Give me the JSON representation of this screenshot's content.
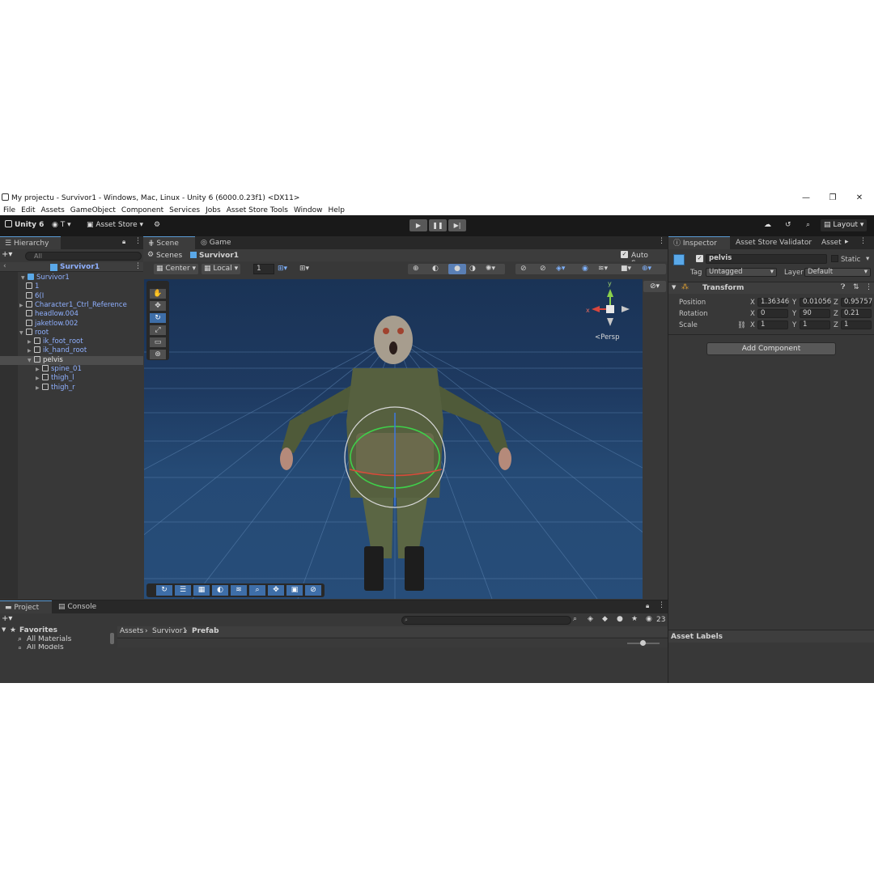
{
  "window": {
    "title": "My projectu - Survivor1 - Windows, Mac, Linux - Unity 6 (6000.0.23f1) <DX11>",
    "minimize": "—",
    "restore": "❐",
    "close": "✕"
  },
  "menu": [
    "File",
    "Edit",
    "Assets",
    "GameObject",
    "Component",
    "Services",
    "Jobs",
    "Asset Store Tools",
    "Window",
    "Help"
  ],
  "toolbar": {
    "unity_label": "Unity 6",
    "account_label": "T",
    "asset_store_label": "Asset Store",
    "layout_label": "Layout"
  },
  "hierarchy": {
    "tab": "Hierarchy",
    "search_placeholder": "All",
    "root_label": "Survivor1",
    "items": [
      {
        "label": "Survivor1",
        "indent": 1,
        "arrow": "▼",
        "selected": false
      },
      {
        "label": "1",
        "indent": 2,
        "arrow": "",
        "selected": false
      },
      {
        "label": "6(I",
        "indent": 2,
        "arrow": "",
        "selected": false
      },
      {
        "label": "Character1_Ctrl_Reference",
        "indent": 2,
        "arrow": "▶",
        "selected": false
      },
      {
        "label": "headlow.004",
        "indent": 2,
        "arrow": "",
        "selected": false
      },
      {
        "label": "jaketlow.002",
        "indent": 2,
        "arrow": "",
        "selected": false
      },
      {
        "label": "root",
        "indent": 2,
        "arrow": "▼",
        "selected": false
      },
      {
        "label": "ik_foot_root",
        "indent": 3,
        "arrow": "▶",
        "selected": false
      },
      {
        "label": "ik_hand_root",
        "indent": 3,
        "arrow": "▶",
        "selected": false
      },
      {
        "label": "pelvis",
        "indent": 3,
        "arrow": "▼",
        "selected": true
      },
      {
        "label": "spine_01",
        "indent": 4,
        "arrow": "▶",
        "selected": false
      },
      {
        "label": "thigh_l",
        "indent": 4,
        "arrow": "▶",
        "selected": false
      },
      {
        "label": "thigh_r",
        "indent": 4,
        "arrow": "▶",
        "selected": false
      }
    ]
  },
  "scene": {
    "tab_scene": "Scene",
    "tab_game": "Game",
    "breadcrumb_scenes": "Scenes",
    "breadcrumb_current": "Survivor1",
    "auto_save": "Auto Save",
    "pivot_center": "Center",
    "pivot_local": "Local",
    "grid_value": "1",
    "persp_label": "<Persp",
    "gizmo_y": "y",
    "gizmo_x": "x"
  },
  "inspector": {
    "tab_inspector": "Inspector",
    "tab_validator": "Asset Store Validator",
    "tab_asset": "Asset S",
    "object_name": "pelvis",
    "static_label": "Static",
    "tag_label": "Tag",
    "tag_value": "Untagged",
    "layer_label": "Layer",
    "layer_value": "Default",
    "transform_label": "Transform",
    "position_label": "Position",
    "rotation_label": "Rotation",
    "scale_label": "Scale",
    "position": {
      "x": "1.36346",
      "y": "0.01056",
      "z": "0.95757"
    },
    "rotation": {
      "x": "0",
      "y": "90",
      "z": "0.21"
    },
    "scale": {
      "x": "1",
      "y": "1",
      "z": "1"
    },
    "axis_x": "X",
    "axis_y": "Y",
    "axis_z": "Z",
    "add_component": "Add Component",
    "asset_labels": "Asset Labels"
  },
  "project": {
    "tab_project": "Project",
    "tab_console": "Console",
    "favorites": "Favorites",
    "all_materials": "All Materials",
    "all_models": "All Models",
    "path": [
      "Assets",
      "Survivor1",
      "Prefab"
    ],
    "hidden_count": "23"
  },
  "colors": {
    "accent": "#5a9bd5",
    "selected_row": "#4d4d4d",
    "hierarchy_text": "#8fb0ff",
    "viewport_top": "#1a3356",
    "viewport_bottom": "#274d79"
  }
}
